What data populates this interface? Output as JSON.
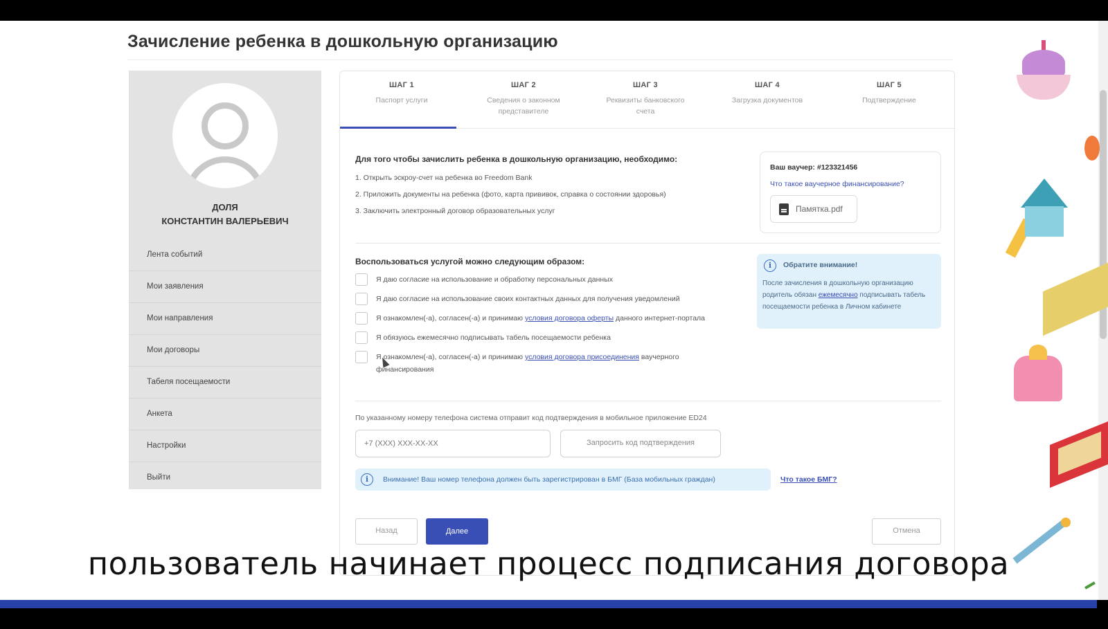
{
  "page": {
    "title": "Зачисление ребенка в дошкольную организацию",
    "caption": "пользователь начинает процесс подписания договора"
  },
  "sidebar": {
    "user_name_line1": "ДОЛЯ",
    "user_name_line2": "КОНСТАНТИН ВАЛЕРЬЕВИЧ",
    "items": [
      {
        "label": "Лента событий"
      },
      {
        "label": "Мои заявления"
      },
      {
        "label": "Мои направления"
      },
      {
        "label": "Мои договоры"
      },
      {
        "label": "Табеля посещаемости"
      },
      {
        "label": "Анкета"
      },
      {
        "label": "Настройки"
      },
      {
        "label": "Выйти"
      }
    ]
  },
  "steps": [
    {
      "num": "ШАГ 1",
      "label": "Паспорт услуги",
      "active": true
    },
    {
      "num": "ШАГ 2",
      "label": "Сведения о законном представителе",
      "active": false
    },
    {
      "num": "ШАГ 3",
      "label": "Реквизиты банковского счета",
      "active": false
    },
    {
      "num": "ШАГ 4",
      "label": "Загрузка документов",
      "active": false
    },
    {
      "num": "ШАГ 5",
      "label": "Подтверждение",
      "active": false
    }
  ],
  "intro": {
    "title": "Для того чтобы зачислить ребенка в дошкольную организацию, необходимо:",
    "items": [
      "1. Открыть эскроу-счет на ребенка во Freedom Bank",
      "2. Приложить документы на ребенка (фото, карта прививок, справка о состоянии здоровья)",
      "3. Заключить электронный договор образовательных услуг"
    ]
  },
  "voucher": {
    "number": "Ваш ваучер: #123321456",
    "link": "Что такое ваучерное финансирование?",
    "pdf_label": "Памятка.pdf"
  },
  "usage": {
    "title": "Воспользоваться услугой можно следующим образом:",
    "checks": [
      {
        "text": "Я даю согласие на использование и обработку персональных данных",
        "checked": false
      },
      {
        "text": "Я даю согласие на использование своих контактных данных для получения уведомлений",
        "checked": false
      },
      {
        "text_before": "Я ознакомлен(-а), согласен(-а) и принимаю ",
        "link": "условия договора оферты",
        "text_after": " данного интернет-портала",
        "checked": false
      },
      {
        "text": "Я обязуюсь ежемесячно подписывать табель посещаемости ребенка",
        "checked": false
      },
      {
        "text_before": "Я ознакомлен(-а), согласен(-а) и принимаю ",
        "link": "условия договора присоединения",
        "text_after": " ваучерного финансирования",
        "checked": false
      }
    ]
  },
  "attention": {
    "title": "Обратите внимание!",
    "text_before": "После зачисления в дошкольную организацию родитель обязан ",
    "link": "ежемесячно",
    "text_after": " подписывать табель посещаемости ребенка в Личном кабинете"
  },
  "phone": {
    "note": "По указанному номеру телефона система отправит код подтверждения в мобильное приложение ED24",
    "placeholder": "+7 (XXX) XXX-XX-XX",
    "request_label": "Запросить код подтверждения"
  },
  "bmg": {
    "text": "Внимание! Ваш номер телефона должен быть зарегистрирован в БМГ (База мобильных граждан)",
    "link": "Что такое БМГ?"
  },
  "actions": {
    "back": "Назад",
    "next": "Далее",
    "cancel": "Отмена"
  },
  "icons": {
    "info": "info-icon",
    "pdf": "pdf-file-icon",
    "avatar": "user-avatar-icon"
  },
  "colors": {
    "accent": "#3a4fb5",
    "info_bg": "#e1f1fb",
    "sidebar_bg": "#e3e3e3"
  }
}
